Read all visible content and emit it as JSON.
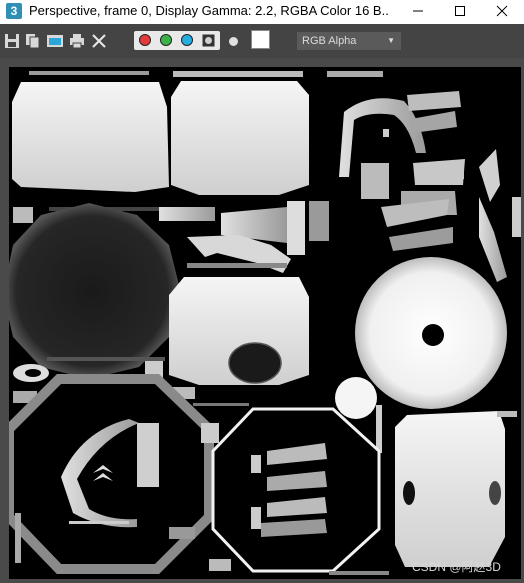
{
  "window": {
    "icon_letter": "3",
    "title": "Perspective, frame 0, Display Gamma: 2.2, RGBA Color 16 B..."
  },
  "toolbar": {
    "icons": [
      "save-icon",
      "copy-icon",
      "clone-icon",
      "print-icon",
      "clear-icon"
    ],
    "channels": [
      {
        "name": "red-channel",
        "color": "#e23b3b"
      },
      {
        "name": "green-channel",
        "color": "#3bb34a"
      },
      {
        "name": "blue-channel",
        "color": "#27aee0"
      },
      {
        "name": "alpha-channel",
        "color": "#9a9a9a"
      }
    ],
    "channel_select": "RGB Alpha",
    "swatch_color": "#ffffff"
  },
  "render": {
    "background": "#000000",
    "watermark": "CSDN @阿赵3D"
  }
}
